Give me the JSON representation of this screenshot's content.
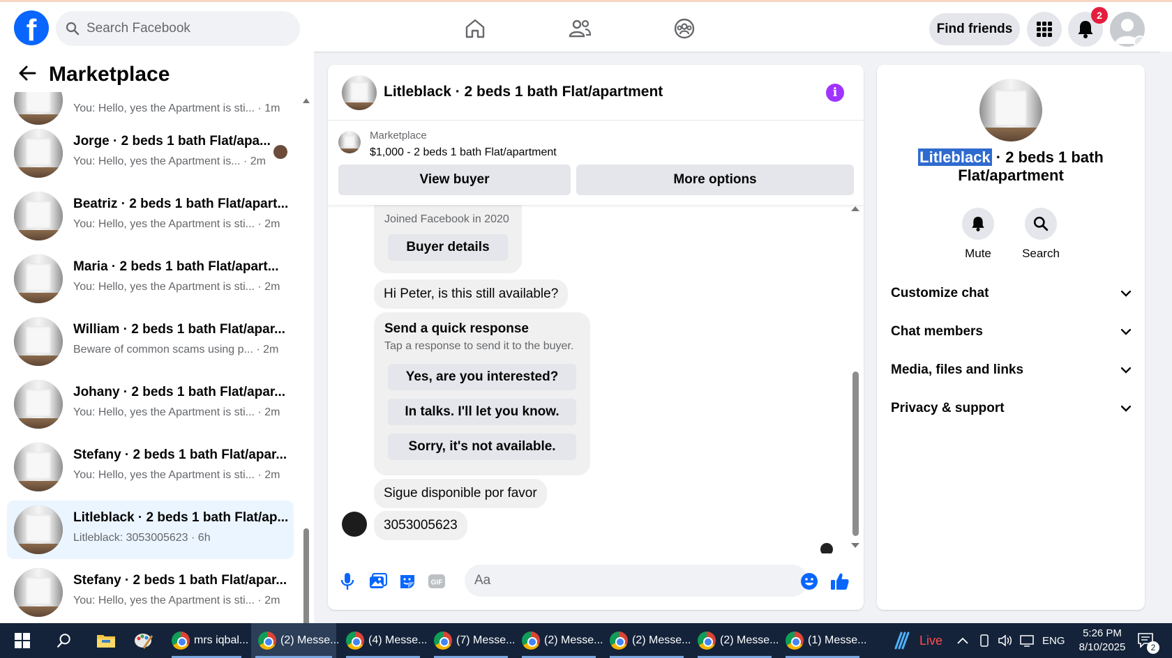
{
  "topbar": {
    "search_placeholder": "Search Facebook",
    "find_friends": "Find friends",
    "notification_count": "2"
  },
  "sidebar": {
    "title": "Marketplace",
    "conversations": [
      {
        "name": "",
        "snippet": "You: Hello, yes the Apartment is sti... · 1m"
      },
      {
        "name": "Jorge · 2 beds 1 bath Flat/apa...",
        "snippet": "You: Hello, yes the Apartment is... · 2m"
      },
      {
        "name": "Beatriz · 2 beds 1 bath Flat/apart...",
        "snippet": "You: Hello, yes the Apartment is sti... · 2m"
      },
      {
        "name": "Maria · 2 beds 1 bath Flat/apart...",
        "snippet": "You: Hello, yes the Apartment is sti... · 2m"
      },
      {
        "name": "William · 2 beds 1 bath Flat/apar...",
        "snippet": "Beware of common scams using p... · 2m"
      },
      {
        "name": "Johany · 2 beds 1 bath Flat/apar...",
        "snippet": "You: Hello, yes the Apartment is sti... · 2m"
      },
      {
        "name": "Stefany · 2 beds 1 bath Flat/apar...",
        "snippet": "You: Hello, yes the Apartment is sti... · 2m"
      },
      {
        "name": "Litleblack · 2 beds 1 bath Flat/ap...",
        "snippet": "Litleblack: 3053005623 · 6h"
      },
      {
        "name": "Stefany · 2 beds 1 bath Flat/apar...",
        "snippet": "You: Hello, yes the Apartment is sti... · 2m"
      }
    ]
  },
  "chat": {
    "title": "Litleblack · 2 beds 1 bath Flat/apartment",
    "listing_label": "Marketplace",
    "listing_price": "$1,000 - 2 beds 1 bath Flat/apartment",
    "view_buyer": "View buyer",
    "more_options": "More options",
    "joined": "Joined Facebook in 2020",
    "buyer_details": "Buyer details",
    "msg1": "Hi Peter, is this still available?",
    "quick_title": "Send a quick response",
    "quick_sub": "Tap a response to send it to the buyer.",
    "quick_1": "Yes, are you interested?",
    "quick_2": "In talks. I'll let you know.",
    "quick_3": "Sorry, it's not available.",
    "msg2": "Sigue disponible por favor",
    "msg3": "3053005623",
    "composer_placeholder": "Aa"
  },
  "rpanel": {
    "name_highlight": "Litleblack",
    "name_rest_1": " · 2 beds 1 bath",
    "name_rest_2": "Flat/apartment",
    "mute": "Mute",
    "search": "Search",
    "items": [
      "Customize chat",
      "Chat members",
      "Media, files and links",
      "Privacy & support"
    ]
  },
  "taskbar": {
    "apps": [
      "mrs iqbal...",
      "(2) Messe...",
      "(4) Messe...",
      "(7) Messe...",
      "(2) Messe...",
      "(2) Messe...",
      "(2) Messe...",
      "(1) Messe..."
    ],
    "live": "Live",
    "lang": "ENG",
    "time": "5:26 PM",
    "date": "8/10/2025",
    "notif": "2"
  }
}
